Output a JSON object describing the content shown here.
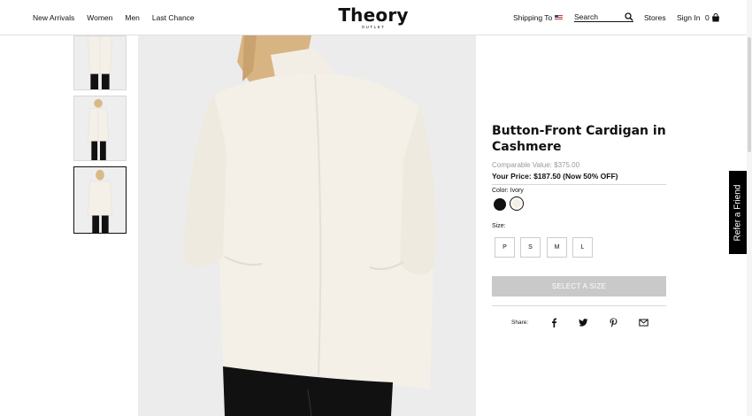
{
  "header": {
    "nav": [
      "New Arrivals",
      "Women",
      "Men",
      "Last Chance"
    ],
    "logo": {
      "main": "Theory",
      "sub": "OUTLET"
    },
    "shipping_label": "Shipping To",
    "search_placeholder": "Search",
    "stores_label": "Stores",
    "signin_label": "Sign In",
    "bag_count": "0"
  },
  "product": {
    "title": "Button-Front Cardigan in Cashmere",
    "comparable_value": "Comparable Value: $375.00",
    "your_price": "Your Price: $187.50 (Now 50% OFF)",
    "color_label": "Color:",
    "color_value": "Ivory",
    "swatches": [
      {
        "name": "black",
        "hex": "#111111"
      },
      {
        "name": "ivory",
        "hex": "#f4efe3",
        "selected": true
      }
    ],
    "size_label": "Size:",
    "sizes": [
      "P",
      "S",
      "M",
      "L"
    ],
    "cta_label": "SELECT A SIZE",
    "share_label": "Share:",
    "share_icons": [
      "facebook-icon",
      "twitter-icon",
      "pinterest-icon",
      "email-icon"
    ]
  },
  "refer_tab": "Refer a Friend",
  "colors": {
    "accent": "#111111",
    "cta_disabled": "#c9c9c9",
    "image_bg": "#ececec",
    "cardigan": "#f3efe6"
  }
}
